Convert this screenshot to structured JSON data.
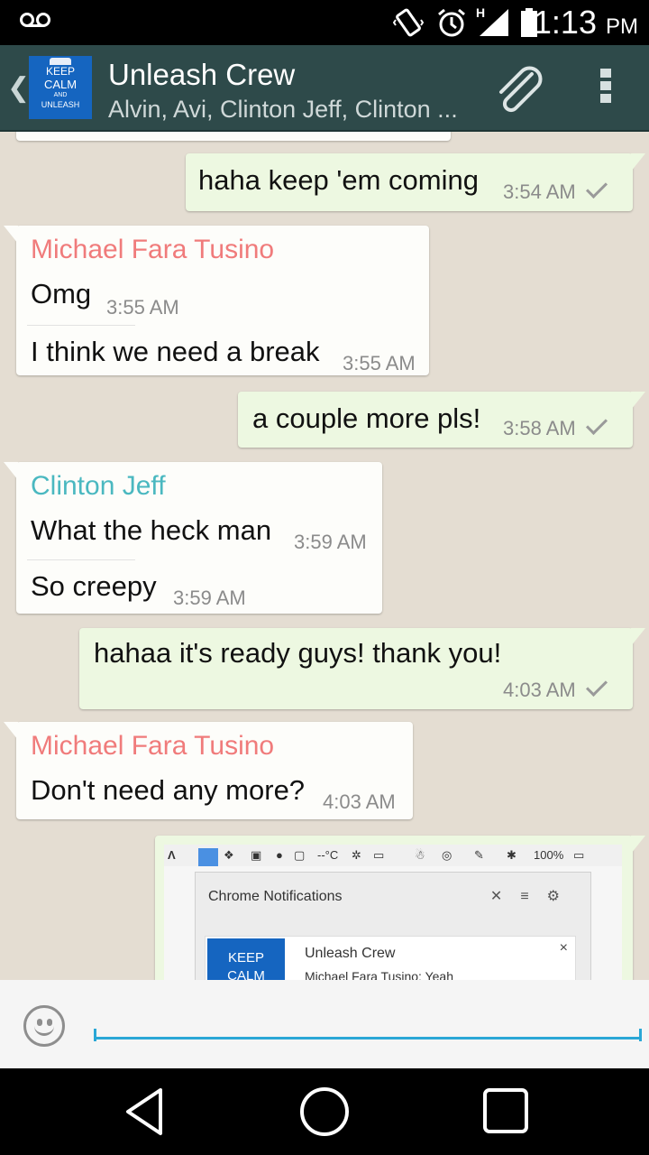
{
  "status_bar": {
    "time": "1:13",
    "ampm": "PM",
    "network": "H",
    "icons": [
      "voicemail-icon",
      "vibrate-icon",
      "alarm-icon",
      "signal-icon",
      "battery-icon"
    ]
  },
  "header": {
    "title": "Unleash Crew",
    "participants": "Alvin, Avi, Clinton Jeff, Clinton ...",
    "avatar_lines": [
      "KEEP",
      "CALM",
      "AND",
      "UNLEASH"
    ],
    "color": "#2e4a4a"
  },
  "messages": [
    {
      "text": "haha keep 'em coming",
      "time": "3:54 AM"
    },
    {
      "sender": "Michael Fara Tusino",
      "sender_color": "#f07b7b",
      "lines": [
        {
          "text": "Omg",
          "time": "3:55 AM"
        },
        {
          "text": "I think we need a break",
          "time": "3:55 AM"
        }
      ]
    },
    {
      "text": "a couple more pls!",
      "time": "3:58 AM"
    },
    {
      "sender": "Clinton Jeff",
      "sender_color": "#4ab8c0",
      "lines": [
        {
          "text": "What the heck man",
          "time": "3:59 AM"
        },
        {
          "text": "So creepy",
          "time": "3:59 AM"
        }
      ]
    },
    {
      "text": "hahaa it's ready guys! thank you!",
      "time": "4:03 AM"
    },
    {
      "sender": "Michael Fara Tusino",
      "sender_color": "#f07b7b",
      "lines": [
        {
          "text": "Don't need any more?",
          "time": "4:03 AM"
        }
      ]
    }
  ],
  "image_message": {
    "statusbar_text": "--°C",
    "battery_text": "100%",
    "notif_panel_title": "Chrome Notifications",
    "card_avatar_lines": [
      "KEEP",
      "CALM"
    ],
    "card_title": "Unleash Crew",
    "card_text": "Michael Fara Tusino: Yeah",
    "card_close": "×"
  },
  "input": {
    "placeholder": ""
  },
  "colors": {
    "accent": "#2aa7d6",
    "outgoing_bubble": "#edf8e1",
    "incoming_bubble": "#fdfdfa",
    "chat_bg": "#e4ddd2"
  }
}
